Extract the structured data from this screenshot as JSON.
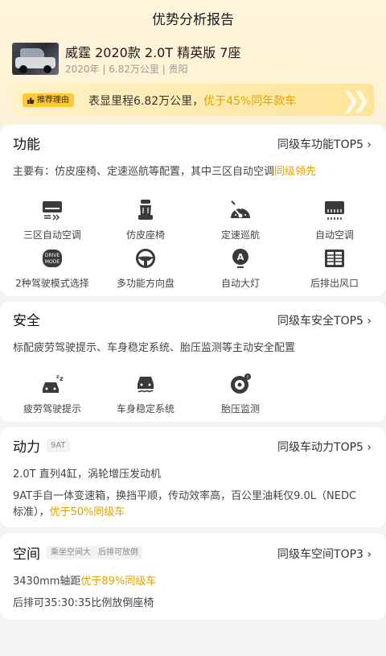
{
  "header": {
    "title": "优势分析报告"
  },
  "car": {
    "name": "威霆 2020款 2.0T 精英版 7座",
    "meta": "2020年 | 6.82万公里 | 贵阳"
  },
  "reason": {
    "badge": "推荐理由",
    "text_plain": "表显里程6.82万公里，",
    "text_highlight": "优于45%同年款车"
  },
  "function": {
    "title": "功能",
    "link": "同级车功能TOP5 ›",
    "desc_plain": "主要有：仿皮座椅、定速巡航等配置，其中三区自动空调",
    "desc_highlight": "同级领先",
    "items": [
      {
        "label": "三区自动空调",
        "icon": "air-conditioner-icon"
      },
      {
        "label": "仿皮座椅",
        "icon": "seat-icon"
      },
      {
        "label": "定速巡航",
        "icon": "speedometer-icon"
      },
      {
        "label": "自动空调",
        "icon": "climate-icon"
      },
      {
        "label": "2种驾驶模式选择",
        "icon": "drive-mode-icon"
      },
      {
        "label": "多功能方向盘",
        "icon": "steering-wheel-icon"
      },
      {
        "label": "自动大灯",
        "icon": "headlight-icon"
      },
      {
        "label": "后排出风口",
        "icon": "rear-vent-icon"
      }
    ]
  },
  "safety": {
    "title": "安全",
    "link": "同级车安全TOP5 ›",
    "desc": "标配疲劳驾驶提示、车身稳定系统、胎压监测等主动安全配置",
    "items": [
      {
        "label": "疲劳驾驶提示",
        "icon": "fatigue-icon"
      },
      {
        "label": "车身稳定系统",
        "icon": "stability-icon"
      },
      {
        "label": "胎压监测",
        "icon": "tire-pressure-icon"
      }
    ]
  },
  "power": {
    "title": "动力",
    "tag": "9AT",
    "link": "同级车动力TOP5 ›",
    "line1": "2.0T 直列4缸，涡轮增压发动机",
    "line2": "9AT手自一体变速箱，换挡平顺，传动效率高，百公里油耗仅9.0L（NEDC",
    "line3_plain": "标准），",
    "line3_highlight": "优于50%同级车"
  },
  "space": {
    "title": "空间",
    "tags": [
      "乘坐空间大",
      "后排可放倒"
    ],
    "link": "同级车空间TOP3 ›",
    "line1_plain": "3430mm轴距",
    "line1_highlight": "优于89%同级车",
    "line2": "后排可35:30:35比例放倒座椅"
  },
  "colors": {
    "accent": "#e0a100",
    "badge": "#ffc934",
    "icon": "#3a3a3a"
  }
}
